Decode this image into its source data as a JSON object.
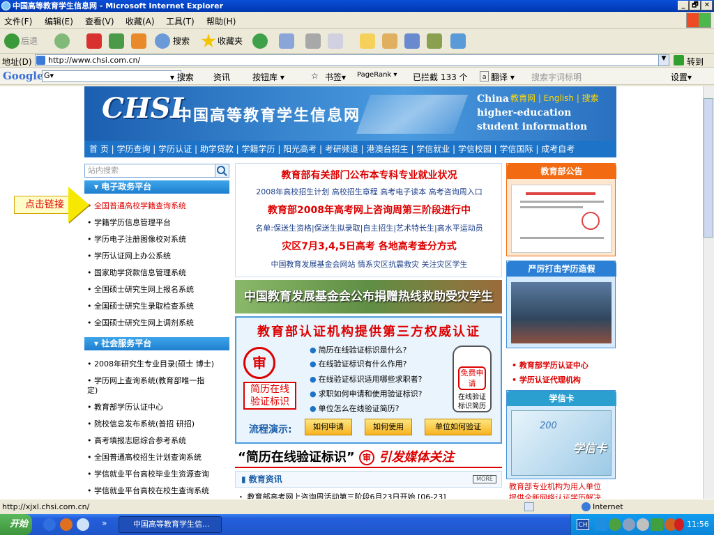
{
  "window": {
    "title": "中国高等教育学生信息网 - Microsoft Internet Explorer",
    "controls": [
      "_",
      "🗗",
      "✕"
    ]
  },
  "menu": [
    "文件(F)",
    "编辑(E)",
    "查看(V)",
    "收藏(A)",
    "工具(T)",
    "帮助(H)"
  ],
  "toolbar": {
    "back": "后退",
    "search": "搜索",
    "favorites": "收藏夹"
  },
  "address": {
    "label": "地址(D)",
    "url": "http://www.chsi.com.cn/",
    "go": "转到"
  },
  "google": {
    "label": "Google",
    "g_box": "G▾",
    "search": "▾ 搜索",
    "news": "资讯",
    "buttons": "按钮库 ▾",
    "bookmarks": "书签▾",
    "pagerank": "PageRank ▾",
    "blocked": "已拦截 133 个",
    "translate": "翻译 ▾",
    "hint": "搜索字词标明",
    "settings": "设置▾"
  },
  "site": {
    "logo": "CHSI",
    "name": "中国高等教育学生信息网",
    "en_lines": [
      "China",
      "higher-education",
      "student  information"
    ],
    "en_top": "教育网 | English | 搜索",
    "nav": "首 页 | 学历查询 | 学历认证 | 助学贷款 | 学籍学历 | 阳光高考 | 考研频道 | 港澳台招生 | 学信就业 | 学信校园 | 学信国际 | 成考自考"
  },
  "sidebar": {
    "search_placeholder": "站内搜索",
    "section1": "电子政务平台",
    "items1": [
      "全国普通高校学籍查询系统",
      "学籍学历信息管理平台",
      "学历电子注册图像校对系统",
      "学历认证网上办公系统",
      "国家助学贷款信息管理系统",
      "全国硕士研究生网上报名系统",
      "全国硕士研究生录取检查系统",
      "全国硕士研究生网上调剂系统"
    ],
    "section2": "社会服务平台",
    "items2": [
      "2008年研究生专业目录(硕士 博士)",
      "学历网上查询系统(教育部唯一指",
      "定)",
      "教育部学历认证中心",
      "院校信息发布系统(普招 研招)",
      "高考填报志愿综合参考系统",
      "全国普通高校招生计划查询系统",
      "学信就业平台高校毕业生资源查询",
      "学信就业平台高校在校生查询系统"
    ]
  },
  "callout": "点击链接",
  "news": {
    "headline1": "教育部有关部门公布本专科专业就业状况",
    "line2": "2008年高校招生计划 高校招生章程 高考电子读本 高考咨询周入口",
    "headline2": "教育部2008年高考网上咨询周第三阶段进行中",
    "line4": "名单:保送生资格|保送生拟录取|自主招生|艺术特长生|高水平运动员",
    "headline3": "灾区7月3,4,5日高考 各地高考查分方式",
    "line6": "中国教育发展基金会网站  情系灾区抗震救灾  关注灾区学生"
  },
  "banner2": "中国教育发展基金会公布捐赠热线救助受灾学生",
  "verify": {
    "title": "教育部认证机构提供第三方权威认证",
    "seal": "审",
    "seal_text": "简历在线\n验证标识",
    "questions": [
      "简历在线验证标识是什么?",
      "在线验证标识有什么作用?",
      "在线验证标识适用哪些求职者?",
      "求职如何申请和使用验证标识?",
      "单位怎么在线验证简历?"
    ],
    "free_label": "免费申请",
    "free_sub": "在线验证标识简历",
    "flow_label": "流程演示:",
    "buttons": [
      "如何申请",
      "如何使用",
      "单位如何验证"
    ]
  },
  "slogan": {
    "text": "“简历在线验证标识”",
    "seal": "审",
    "hl": "引发媒体关注"
  },
  "news_info": {
    "label": "教育资讯",
    "more": "MORE",
    "cut": "・ 教育部高考网上咨询周活动第三阶段6月23日开始   [06-23]"
  },
  "right": {
    "notice": "教育部公告",
    "fake": "严厉打击学历造假",
    "links": [
      "• 教育部学历认证中心",
      "• 学历认证代理机构"
    ],
    "xuexin": "学信卡",
    "card_year": "200",
    "card_text": "学信卡",
    "bottom1": "教育部专业机构为用人单位",
    "bottom2": "提供全新网络认证学历解决"
  },
  "status": {
    "url": "http://xjxl.chsi.com.cn/",
    "zone": "Internet"
  },
  "taskbar": {
    "start": "开始",
    "window": "中国高等教育学生信...",
    "time": "11:56",
    "ime": "CH"
  }
}
